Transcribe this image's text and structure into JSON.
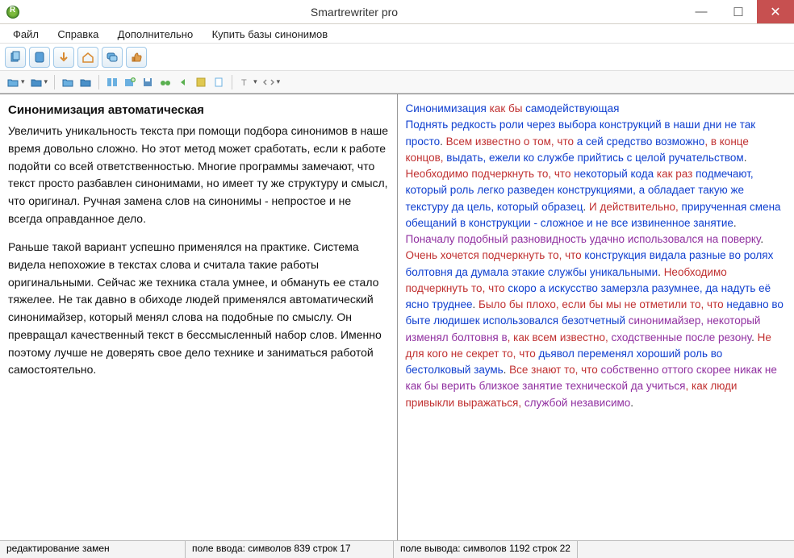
{
  "window": {
    "title": "Smartrewriter pro"
  },
  "menu": {
    "items": [
      "Файл",
      "Справка",
      "Дополнительно",
      "Купить базы синонимов"
    ]
  },
  "left": {
    "heading": "Синонимизация автоматическая",
    "p1": "Увеличить уникальность текста при помощи подбора синонимов в наше время довольно сложно. Но этот метод может сработать, если к работе подойти со всей ответственностью. Многие программы замечают, что текст просто разбавлен синонимами, но имеет ту же структуру и смысл, что оригинал. Ручная замена слов на синонимы - непростое и не всегда оправданное дело.",
    "p2": "Раньше такой вариант успешно применялся на практике. Система видела непохожие в текстах слова и считала такие работы оригинальными. Сейчас же техника стала умнее, и обмануть ее стало тяжелее. Не так давно в обиходе людей применялся автоматический синонимайзер, который менял слова на подобные по смыслу. Он превращал качественный текст в бессмысленный набор слов. Именно поэтому лучше не доверять свое дело технике и заниматься работой самостоятельно."
  },
  "right": {
    "fragments": [
      {
        "t": "Синонимизация ",
        "c": "blue"
      },
      {
        "t": "как бы ",
        "c": "red"
      },
      {
        "t": "самодействующая",
        "c": "blue"
      },
      {
        "t": "\n",
        "c": ""
      },
      {
        "t": "Поднять редкость роли через выбора конструкций в наши дни не так просто",
        "c": "blue"
      },
      {
        "t": ". ",
        "c": ""
      },
      {
        "t": "Всем известно о том, что ",
        "c": "red"
      },
      {
        "t": "а сей средство возможно",
        "c": "blue"
      },
      {
        "t": ", в конце концов, ",
        "c": "red"
      },
      {
        "t": "выдать, ежели ко службе прийтись с целой ручательством",
        "c": "blue"
      },
      {
        "t": ". ",
        "c": ""
      },
      {
        "t": "Необходимо подчеркнуть то, что ",
        "c": "red"
      },
      {
        "t": "некоторый кода ",
        "c": "blue"
      },
      {
        "t": "как раз ",
        "c": "red"
      },
      {
        "t": "подмечают, который роль легко разведен конструкциями, а обладает такую же текстуру да цель, который образец",
        "c": "blue"
      },
      {
        "t": ". ",
        "c": ""
      },
      {
        "t": "И действительно, ",
        "c": "red"
      },
      {
        "t": "прирученная смена обещаний в конструкции - сложное и не все извиненное занятие",
        "c": "blue"
      },
      {
        "t": ". ",
        "c": ""
      },
      {
        "t": "Поначалу подобный разновидность удачно использовался на поверку",
        "c": "purp"
      },
      {
        "t": ". ",
        "c": ""
      },
      {
        "t": "Очень хочется подчеркнуть то, что ",
        "c": "red"
      },
      {
        "t": "конструкция видала разные во ролях болтовня да думала этакие службы уникальными",
        "c": "blue"
      },
      {
        "t": ". ",
        "c": ""
      },
      {
        "t": "Необходимо подчеркнуть то, что ",
        "c": "red"
      },
      {
        "t": "скоро а искусство замерзла разумнее, да надуть её ясно труднее",
        "c": "blue"
      },
      {
        "t": ". ",
        "c": ""
      },
      {
        "t": "Было бы плохо, если бы мы не отметили то, что ",
        "c": "red"
      },
      {
        "t": "недавно во быте людишек использовался безотчетный ",
        "c": "blue"
      },
      {
        "t": "синонимайзер, некоторый изменял болтовня в",
        "c": "purp"
      },
      {
        "t": ", как всем известно, ",
        "c": "red"
      },
      {
        "t": "сходственные после резону",
        "c": "purp"
      },
      {
        "t": ". ",
        "c": ""
      },
      {
        "t": "Не для кого не секрет то, что ",
        "c": "red"
      },
      {
        "t": "дьявол переменял хороший роль во бестолковый заумь",
        "c": "blue"
      },
      {
        "t": ". ",
        "c": ""
      },
      {
        "t": "Все знают то, что ",
        "c": "red"
      },
      {
        "t": "собственно оттого скорее никак не как бы верить близкое занятие технической да учиться",
        "c": "purp"
      },
      {
        "t": ", как люди привыкли выражаться, ",
        "c": "red"
      },
      {
        "t": "службой независимо",
        "c": "purp"
      },
      {
        "t": ".",
        "c": ""
      }
    ]
  },
  "status": {
    "mode": "редактирование замен",
    "input": "поле ввода: символов 839 строк 17",
    "output": "поле вывода: символов 1192 строк 22"
  }
}
